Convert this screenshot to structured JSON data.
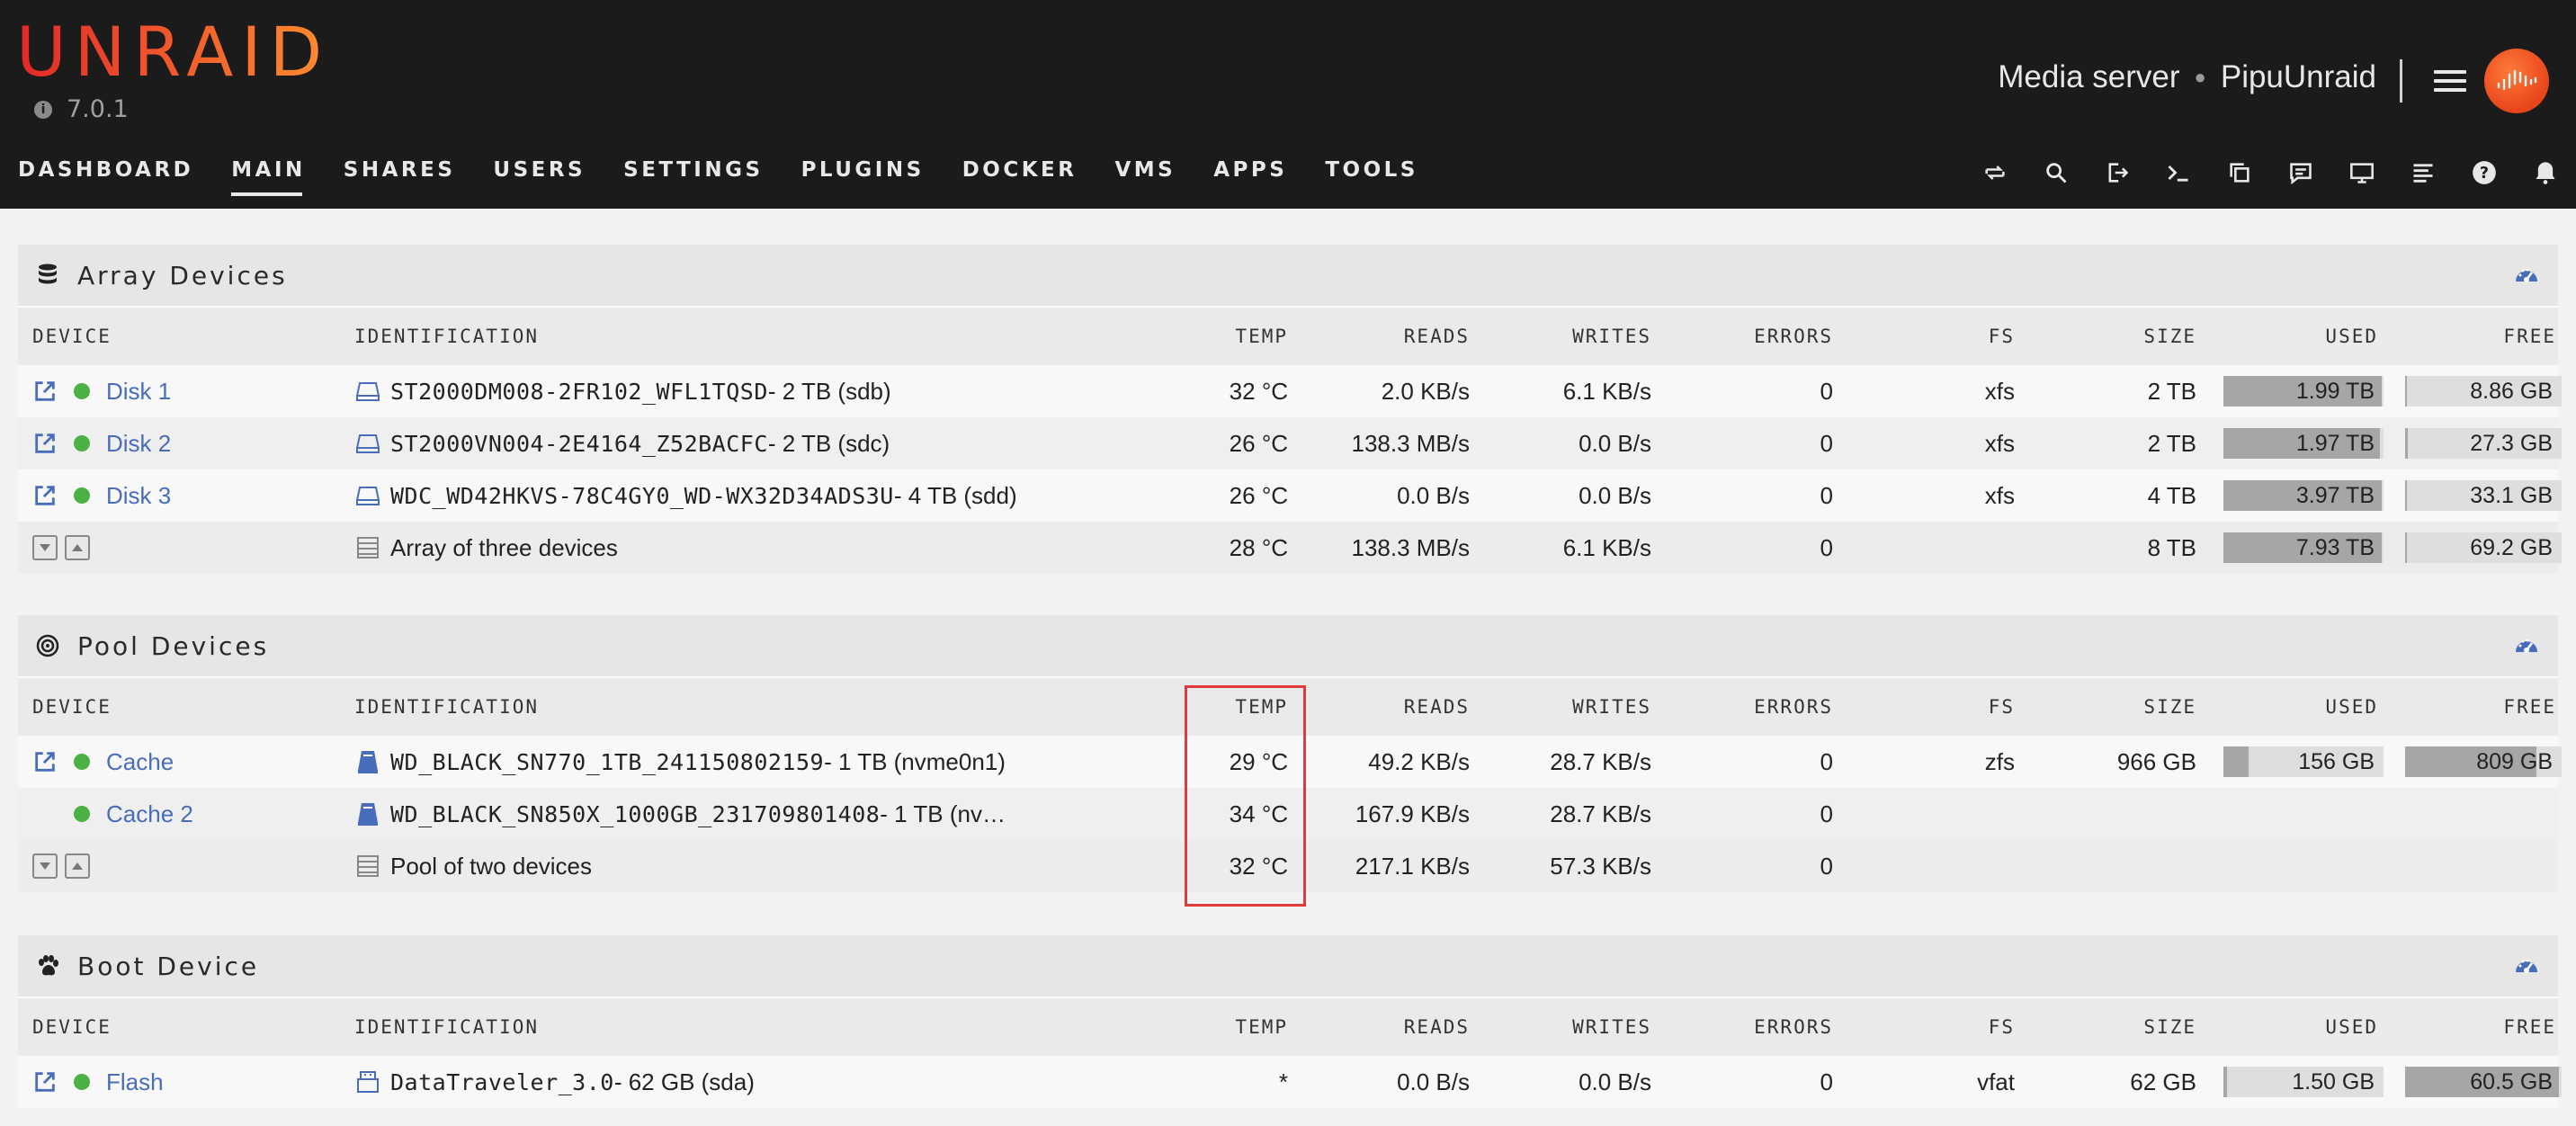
{
  "brand": {
    "logo": "UNRAID",
    "version": "7.0.1"
  },
  "server": {
    "description": "Media server",
    "name": "PipuUnraid"
  },
  "nav": [
    "DASHBOARD",
    "MAIN",
    "SHARES",
    "USERS",
    "SETTINGS",
    "PLUGINS",
    "DOCKER",
    "VMS",
    "APPS",
    "TOOLS"
  ],
  "nav_active": "MAIN",
  "tool_icons": [
    "sync-icon",
    "search-icon",
    "logout-icon",
    "terminal-icon",
    "copy-icon",
    "feedback-icon",
    "monitor-icon",
    "log-icon",
    "help-icon",
    "bell-icon"
  ],
  "columns": [
    "DEVICE",
    "IDENTIFICATION",
    "TEMP",
    "READS",
    "WRITES",
    "ERRORS",
    "FS",
    "SIZE",
    "USED",
    "FREE"
  ],
  "array": {
    "title": "Array Devices",
    "rows": [
      {
        "device": "Disk 1",
        "id": "ST2000DM008-2FR102_WFL1TQSD",
        "id_suffix": " - 2 TB (sdb)",
        "temp": "32 °C",
        "reads": "2.0 KB/s",
        "writes": "6.1 KB/s",
        "errors": "0",
        "fs": "xfs",
        "size": "2 TB",
        "used": "1.99 TB",
        "free": "8.86 GB",
        "used_pct": 99,
        "free_pct": 1
      },
      {
        "device": "Disk 2",
        "id": "ST2000VN004-2E4164_Z52BACFC",
        "id_suffix": " - 2 TB (sdc)",
        "temp": "26 °C",
        "reads": "138.3 MB/s",
        "writes": "0.0 B/s",
        "errors": "0",
        "fs": "xfs",
        "size": "2 TB",
        "used": "1.97 TB",
        "free": "27.3 GB",
        "used_pct": 98,
        "free_pct": 2
      },
      {
        "device": "Disk 3",
        "id": "WDC_WD42HKVS-78C4GY0_WD-WX32D34ADS3U",
        "id_suffix": " - 4 TB (sdd)",
        "temp": "26 °C",
        "reads": "0.0 B/s",
        "writes": "0.0 B/s",
        "errors": "0",
        "fs": "xfs",
        "size": "4 TB",
        "used": "3.97 TB",
        "free": "33.1 GB",
        "used_pct": 99,
        "free_pct": 1
      }
    ],
    "total": {
      "label": "Array of three devices",
      "temp": "28 °C",
      "reads": "138.3 MB/s",
      "writes": "6.1 KB/s",
      "errors": "0",
      "size": "8 TB",
      "used": "7.93 TB",
      "free": "69.2 GB",
      "used_pct": 99,
      "free_pct": 1
    }
  },
  "pool": {
    "title": "Pool Devices",
    "rows": [
      {
        "device": "Cache",
        "id": "WD_BLACK_SN770_1TB_241150802159",
        "id_suffix": " - 1 TB (nvme0n1)",
        "temp": "29 °C",
        "reads": "49.2 KB/s",
        "writes": "28.7 KB/s",
        "errors": "0",
        "fs": "zfs",
        "size": "966 GB",
        "used": "156 GB",
        "free": "809 GB",
        "used_pct": 16,
        "free_pct": 84
      },
      {
        "device": "Cache 2",
        "id": "WD_BLACK_SN850X_1000GB_231709801408",
        "id_suffix": " - 1 TB (nv…",
        "temp": "34 °C",
        "reads": "167.9 KB/s",
        "writes": "28.7 KB/s",
        "errors": "0"
      }
    ],
    "total": {
      "label": "Pool of two devices",
      "temp": "32 °C",
      "reads": "217.1 KB/s",
      "writes": "57.3 KB/s",
      "errors": "0"
    }
  },
  "boot": {
    "title": "Boot Device",
    "rows": [
      {
        "device": "Flash",
        "id": "DataTraveler_3.0",
        "id_suffix": " - 62 GB (sda)",
        "temp": "*",
        "reads": "0.0 B/s",
        "writes": "0.0 B/s",
        "errors": "0",
        "fs": "vfat",
        "size": "62 GB",
        "used": "1.50 GB",
        "free": "60.5 GB",
        "used_pct": 2,
        "free_pct": 98
      }
    ]
  },
  "colors": {
    "link": "#486dba",
    "status_ok": "#4ab142",
    "highlight": "#e03a3a",
    "header_bg": "#1c1b1b"
  }
}
